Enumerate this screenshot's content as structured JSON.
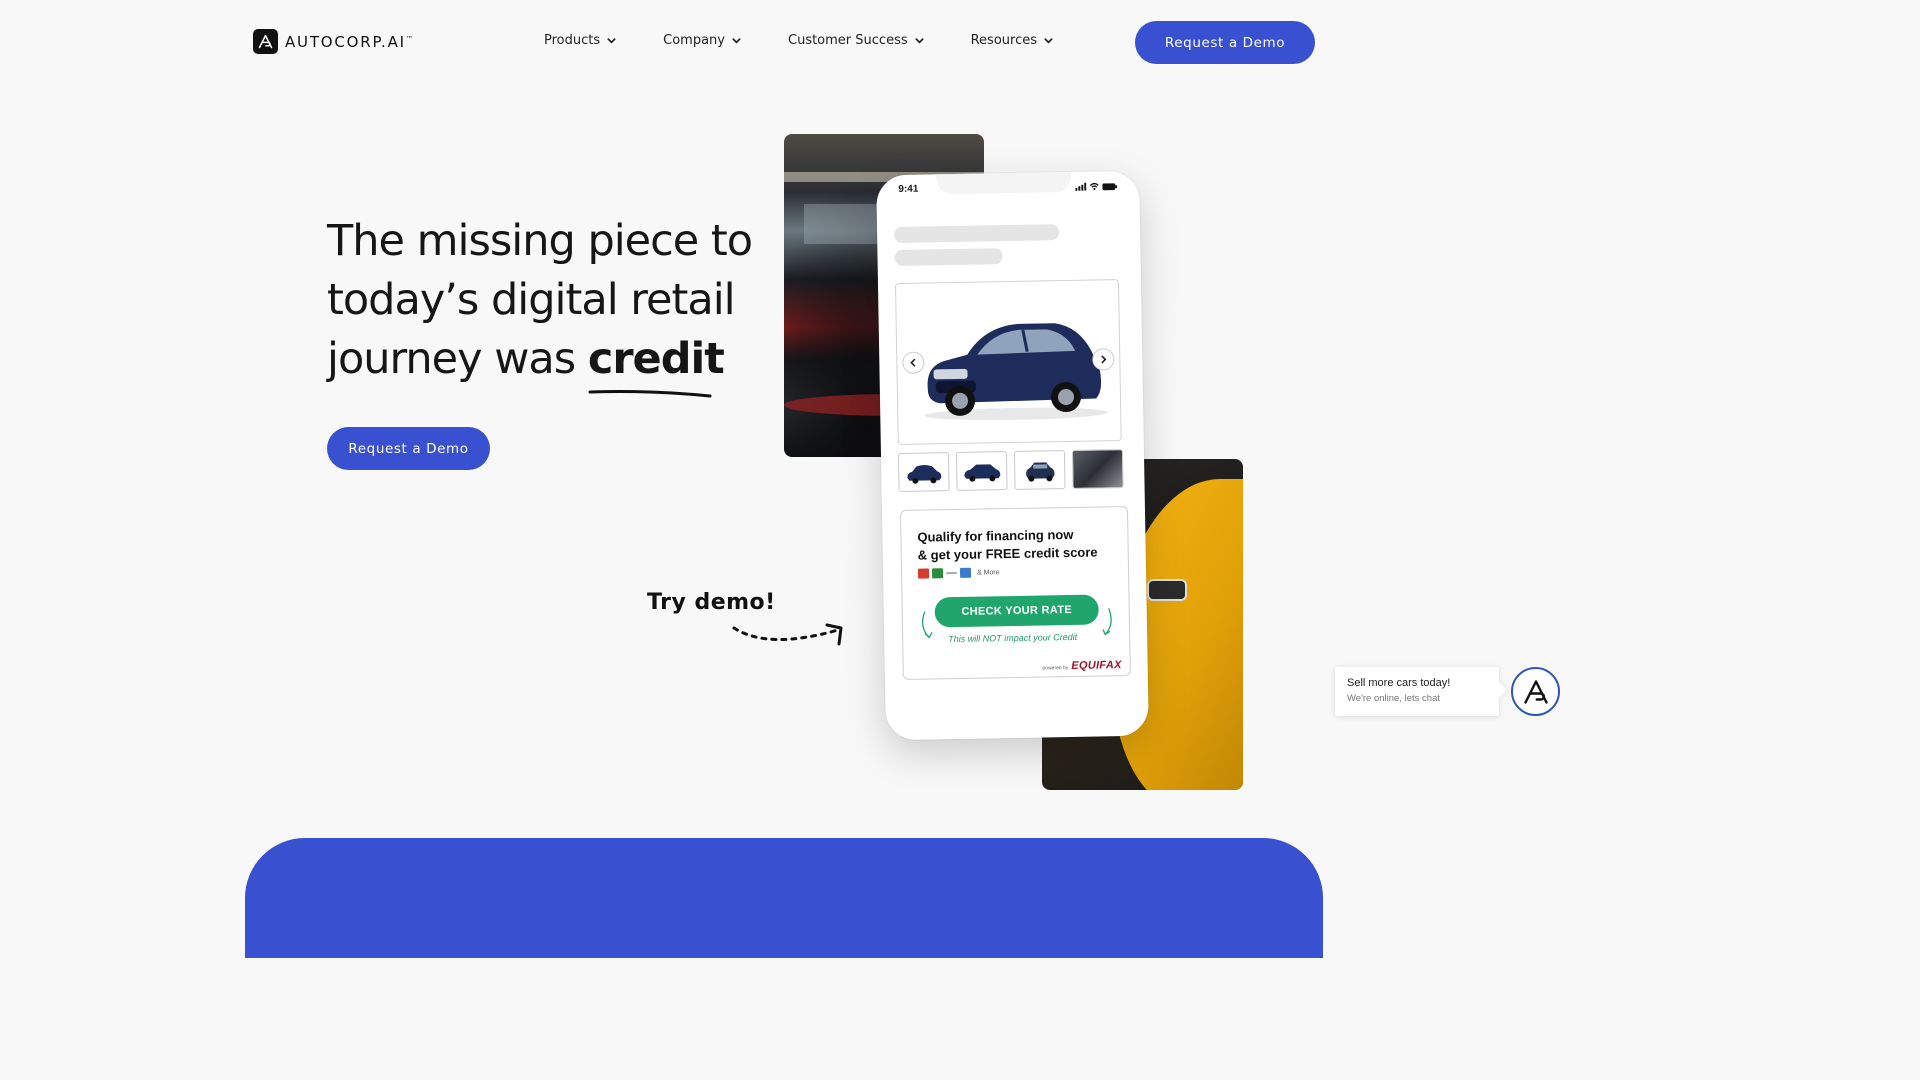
{
  "brand": {
    "name": "AUTOCORP.AI",
    "tm": "™"
  },
  "nav": {
    "items": [
      {
        "label": "Products"
      },
      {
        "label": "Company"
      },
      {
        "label": "Customer Success"
      },
      {
        "label": "Resources"
      }
    ],
    "cta_label": "Request a Demo"
  },
  "hero": {
    "title_line1": "The missing piece to",
    "title_line2": "today’s digital retail",
    "title_line3_prefix": "journey was",
    "title_highlight": "credit",
    "cta_label": "Request a Demo",
    "try_demo": "Try demo!"
  },
  "phone": {
    "time": "9:41",
    "finance_title_line1": "Qualify for financing now",
    "finance_title_line2": "& get your FREE credit score",
    "lenders_more": "& More",
    "cta_label": "CHECK YOUR RATE",
    "cta_note": "This will NOT impact your Credit",
    "powered_by": "powered by",
    "powered_brand": "EQUIFAX"
  },
  "chat": {
    "title": "Sell more cars today!",
    "subtitle": "We're online, lets chat"
  },
  "colors": {
    "primary": "#3951d1",
    "cta_green": "#20a66c",
    "equifax_red": "#a3112a"
  }
}
